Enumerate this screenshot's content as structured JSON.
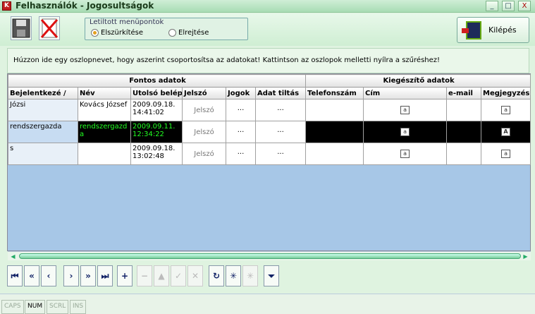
{
  "window": {
    "title": "Felhasználók - Jogosultságok",
    "app_icon": "app-icon",
    "min": "_",
    "max": "□",
    "close": "X"
  },
  "toolbar": {
    "save_icon": "floppy-save-icon",
    "delete_icon": "delete-cross-icon",
    "group_title": "Letiltott menüpontok",
    "radio_gray": "Elszürkítése",
    "radio_hide": "Elrejtése",
    "radio_selected": "Elszürkítése",
    "exit_label": "Kilépés"
  },
  "group_hint": "Húzzon ide egy oszlopnevet, hogy aszerint csoportosítsa az adatokat! Kattintson az oszlopok melletti nyílra a szűréshez!",
  "grid": {
    "bands": [
      "Fontos adatok",
      "Kiegészítő adatok"
    ],
    "columns": [
      "Bejelentkezé",
      "Név",
      "Utolsó belép",
      "Jelszó",
      "Jogok",
      "Adat tiltás",
      "Telefonszám",
      "Cím",
      "e-mail",
      "Megjegyzés"
    ],
    "sort_indicator": "/",
    "rows": [
      {
        "login": "Józsi",
        "name": "Kovács József",
        "last_login": "2009.09.18. 14:41:02",
        "password": "Jelszó",
        "rights": "···",
        "block": "···"
      },
      {
        "login": "rendszergazda",
        "name": "rendszergazd a",
        "last_login": "2009.09.11. 12:34:22",
        "password": "Jelszó",
        "rights": "···",
        "block": "···",
        "selected": true
      },
      {
        "login": "s",
        "name": "",
        "last_login": "2009.09.18. 13:02:48",
        "password": "Jelszó",
        "rights": "···",
        "block": "···"
      }
    ],
    "note_icon": "a",
    "note_icon_selected": "A"
  },
  "navigator": {
    "buttons": [
      "⏮",
      "«",
      "‹",
      "›",
      "»",
      "⏭",
      "+",
      "−",
      "▲",
      "✓",
      "✕",
      "↻",
      "✳",
      "✳",
      "⏷"
    ]
  },
  "statusbar": {
    "caps": "CAPS",
    "num": "NUM",
    "scrl": "SCRL",
    "ins": "INS"
  },
  "colors": {
    "selected_row_bg": "#000000",
    "selected_text": "#22ff22",
    "grid_bg": "#a7c7e7"
  }
}
